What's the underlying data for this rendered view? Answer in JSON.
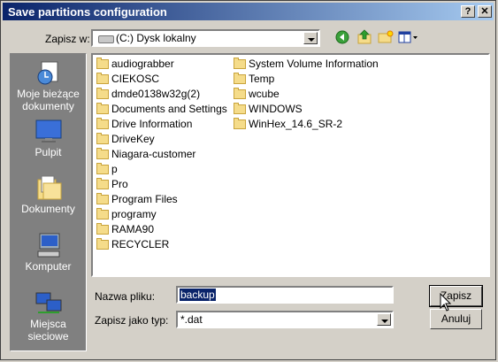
{
  "window": {
    "title": "Save partitions configuration",
    "help_label": "?",
    "close_label": "✕"
  },
  "toolbar": {
    "look_in_label": "Zapisz w:",
    "location_value": "(C:) Dysk lokalny"
  },
  "places": [
    {
      "label": "Moje bieżące dokumenty",
      "icon": "recent-documents-icon"
    },
    {
      "label": "Pulpit",
      "icon": "desktop-icon"
    },
    {
      "label": "Dokumenty",
      "icon": "documents-icon"
    },
    {
      "label": "Komputer",
      "icon": "computer-icon"
    },
    {
      "label": "Miejsca sieciowe",
      "icon": "network-places-icon"
    }
  ],
  "files_col1": [
    "audiograbber",
    "CIEKOSC",
    "dmde0138w32g(2)",
    "Documents and Settings",
    "Drive Information",
    "DriveKey",
    "Niagara-customer",
    "p",
    "Pro",
    "Program Files",
    "programy",
    "RAMA90",
    "RECYCLER"
  ],
  "files_col2": [
    "System Volume Information",
    "Temp",
    "wcube",
    "WINDOWS",
    "WinHex_14.6_SR-2"
  ],
  "form": {
    "filename_label": "Nazwa pliku:",
    "filename_value": "backup",
    "filetype_label": "Zapisz jako typ:",
    "filetype_value": "*.dat",
    "save_label": "Zapisz",
    "cancel_label": "Anuluj"
  }
}
